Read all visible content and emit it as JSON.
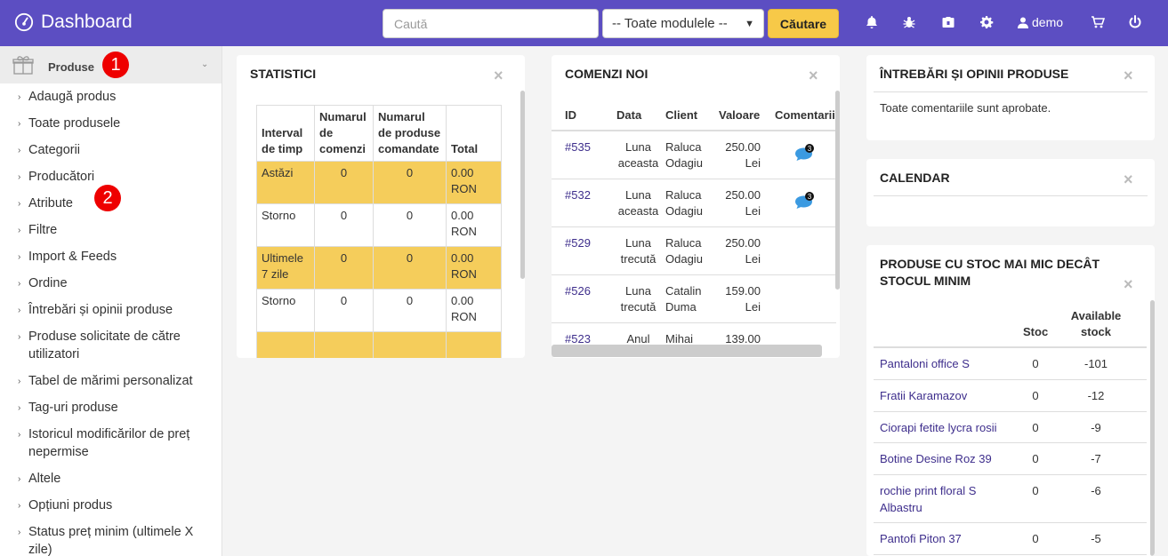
{
  "header": {
    "title": "Dashboard",
    "search_placeholder": "Caută",
    "module_select": "-- Toate modulele --",
    "search_button": "Căutare",
    "user": "demo"
  },
  "sidebar": {
    "section": "Produse",
    "badge1": "1",
    "badge2": "2",
    "items": [
      "Adaugă produs",
      "Toate produsele",
      "Categorii",
      "Producători",
      "Atribute",
      "Filtre",
      "Import & Feeds",
      "Ordine",
      "Întrebări și opinii produse",
      "Produse solicitate de către utilizatori",
      "Tabel de mărimi personalizat",
      "Tag-uri produse",
      "Istoricul modificărilor de preț nepermise",
      "Altele",
      "Opțiuni produs",
      "Status preț minim (ultimele X zile)"
    ]
  },
  "statistics": {
    "title": "STATISTICI",
    "headers": [
      "Interval de timp",
      "Numarul de comenzi",
      "Numarul de produse comandate",
      "Total"
    ],
    "rows": [
      [
        "Astăzi",
        "0",
        "0",
        "0.00 RON"
      ],
      [
        "Storno",
        "0",
        "0",
        "0.00 RON"
      ],
      [
        "Ultimele 7 zile",
        "0",
        "0",
        "0.00 RON"
      ],
      [
        "Storno",
        "0",
        "0",
        "0.00 RON"
      ]
    ]
  },
  "orders": {
    "title": "COMENZI NOI",
    "headers": [
      "ID",
      "Data",
      "Client",
      "Valoare",
      "Comentarii"
    ],
    "rows": [
      {
        "id": "#535",
        "date": "Luna aceasta",
        "client": "Raluca Odagiu",
        "value": "250.00 Lei",
        "comments": "3"
      },
      {
        "id": "#532",
        "date": "Luna aceasta",
        "client": "Raluca Odagiu",
        "value": "250.00 Lei",
        "comments": "3"
      },
      {
        "id": "#529",
        "date": "Luna trecută",
        "client": "Raluca Odagiu",
        "value": "250.00 Lei",
        "comments": ""
      },
      {
        "id": "#526",
        "date": "Luna trecută",
        "client": "Catalin Duma",
        "value": "159.00 Lei",
        "comments": ""
      },
      {
        "id": "#523",
        "date": "Anul",
        "client": "Mihai",
        "value": "139.00",
        "comments": ""
      }
    ]
  },
  "questions": {
    "title": "ÎNTREBĂRI ȘI OPINII PRODUSE",
    "text": "Toate comentariile sunt aprobate."
  },
  "calendar": {
    "title": "CALENDAR"
  },
  "stock": {
    "title": "PRODUSE CU STOC MAI MIC DECÂT STOCUL MINIM",
    "headers": [
      "Stoc",
      "Available stock"
    ],
    "rows": [
      {
        "name": "Pantaloni office S",
        "stock": "0",
        "available": "-101"
      },
      {
        "name": "Fratii Karamazov",
        "stock": "0",
        "available": "-12"
      },
      {
        "name": "Ciorapi fetite lycra rosii",
        "stock": "0",
        "available": "-9"
      },
      {
        "name": "Botine Desine Roz 39",
        "stock": "0",
        "available": "-7"
      },
      {
        "name": "rochie print floral S Albastru",
        "stock": "0",
        "available": "-6"
      },
      {
        "name": "Pantofi Piton 37",
        "stock": "0",
        "available": "-5"
      }
    ]
  },
  "colors": {
    "header": "#5c4ec2",
    "accent": "#f7c948",
    "highlight_row": "#f5cd5b",
    "badge": "#e00000",
    "link": "#3e2e8c"
  },
  "icons": [
    "dashboard-icon",
    "bell-icon",
    "bug-icon",
    "briefcase-icon",
    "gear-icon",
    "user-icon",
    "cart-icon",
    "power-icon",
    "gift-icon",
    "chat-icon",
    "close-icon"
  ]
}
